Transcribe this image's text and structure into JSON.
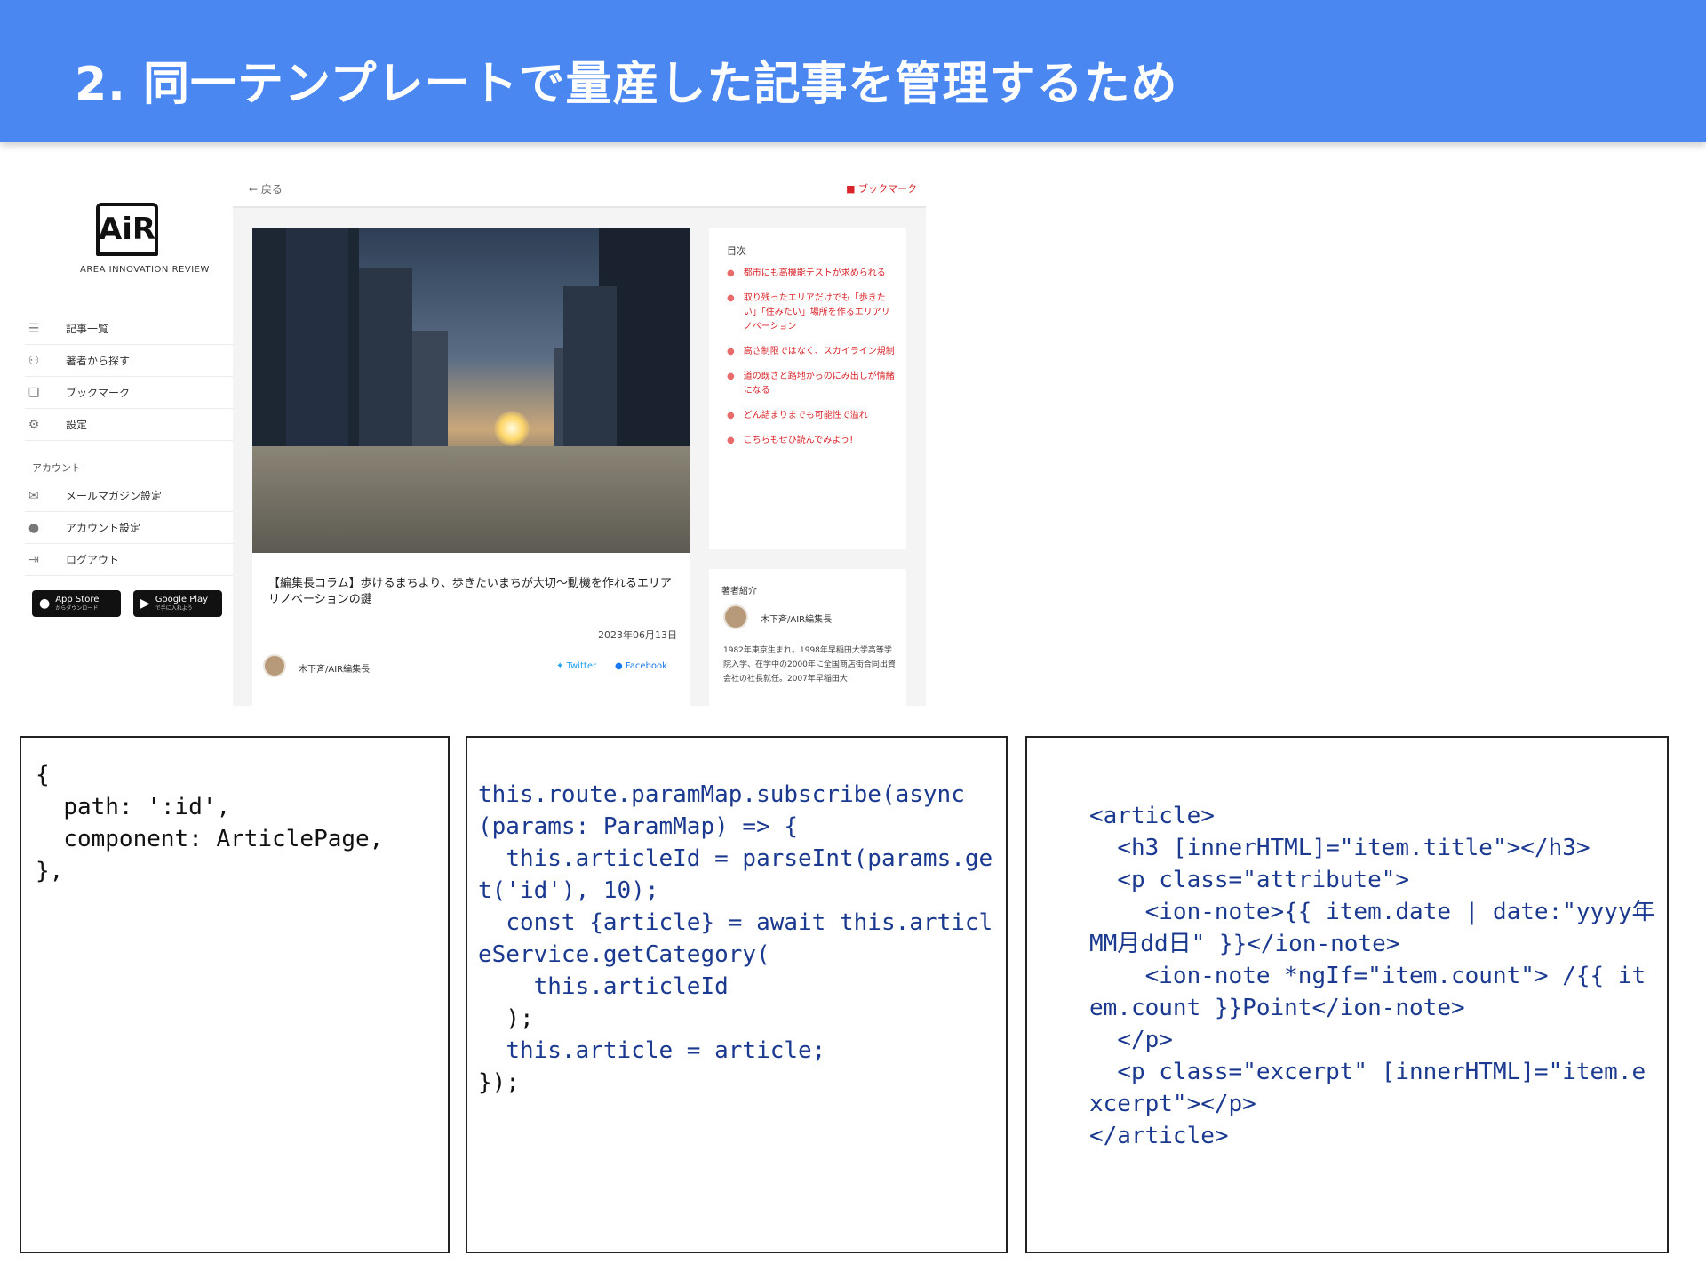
{
  "slide": {
    "title": "2. 同一テンプレートで量産した記事を管理するため"
  },
  "sidebar": {
    "logo_text": "AiR",
    "logo_sub": "AREA INNOVATION REVIEW",
    "nav_items": [
      {
        "icon": "list-icon",
        "label": "記事一覧"
      },
      {
        "icon": "people-icon",
        "label": "著者から探す"
      },
      {
        "icon": "bookmark-icon",
        "label": "ブックマーク"
      },
      {
        "icon": "gear-icon",
        "label": "設定"
      }
    ],
    "account_section": "アカウント",
    "account_items": [
      {
        "icon": "mail-icon",
        "label": "メールマガジン設定"
      },
      {
        "icon": "user-icon",
        "label": "アカウント設定"
      },
      {
        "icon": "logout-icon",
        "label": "ログアウト"
      }
    ],
    "app_store": {
      "main": "App Store",
      "sub": "からダウンロード"
    },
    "google_play": {
      "main": "Google Play",
      "sub": "で手に入れよう"
    }
  },
  "topbar": {
    "back_label": "戻る",
    "bookmark_label": "ブックマーク"
  },
  "article": {
    "title": "【編集長コラム】歩けるまちより、歩きたいまちが大切〜動機を作れるエリアリノベーションの鍵",
    "date": "2023年06月13日",
    "author": "木下斉/AIR編集長",
    "share_twitter": "Twitter",
    "share_facebook": "Facebook"
  },
  "toc": {
    "heading": "目次",
    "items": [
      "都市にも高機能テストが求められる",
      "取り残ったエリアだけでも「歩きたい」「住みたい」場所を作るエリアリノベーション",
      "高さ制限ではなく、スカイライン規制",
      "道の既さと路地からのにみ出しが情緒になる",
      "どん詰まりまでも可能性で溢れ",
      "こちらもぜひ読んでみよう!"
    ]
  },
  "author_card": {
    "heading": "著者紹介",
    "name": "木下斉/AIR編集長",
    "bio": "1982年東京生まれ。1998年早稲田大学高等学院入学、在学中の2000年に全国商店街合同出資会社の社長就任。2007年早稲田大"
  },
  "code": {
    "routing": [
      "{",
      "  path: ':id',",
      "  component: ArticlePage,",
      "},"
    ],
    "component": [
      "this.route.paramMap.subscribe(async (params: ParamMap) => {",
      "  this.articleId = parseInt(params.get('id'), 10);",
      "  const {article} = await this.articleService.getCategory(",
      "    this.articleId",
      "  );",
      "  this.article = article;",
      "});"
    ],
    "template": [
      "<article>",
      "  <h3 [innerHTML]=\"item.title\"></h3>",
      "  <p class=\"attribute\">",
      "    <ion-note>{{ item.date | date:\"yyyy年MM月dd日\" }}</ion-note>",
      "    <ion-note *ngIf=\"item.count\"> /{{ item.count }}Point</ion-note>",
      "  </p>",
      "  <p class=\"excerpt\" [innerHTML]=\"item.excerpt\"></p>",
      "</article>"
    ]
  },
  "colors": {
    "header_bg": "#4a87f1",
    "accent_red": "#d8232a"
  }
}
